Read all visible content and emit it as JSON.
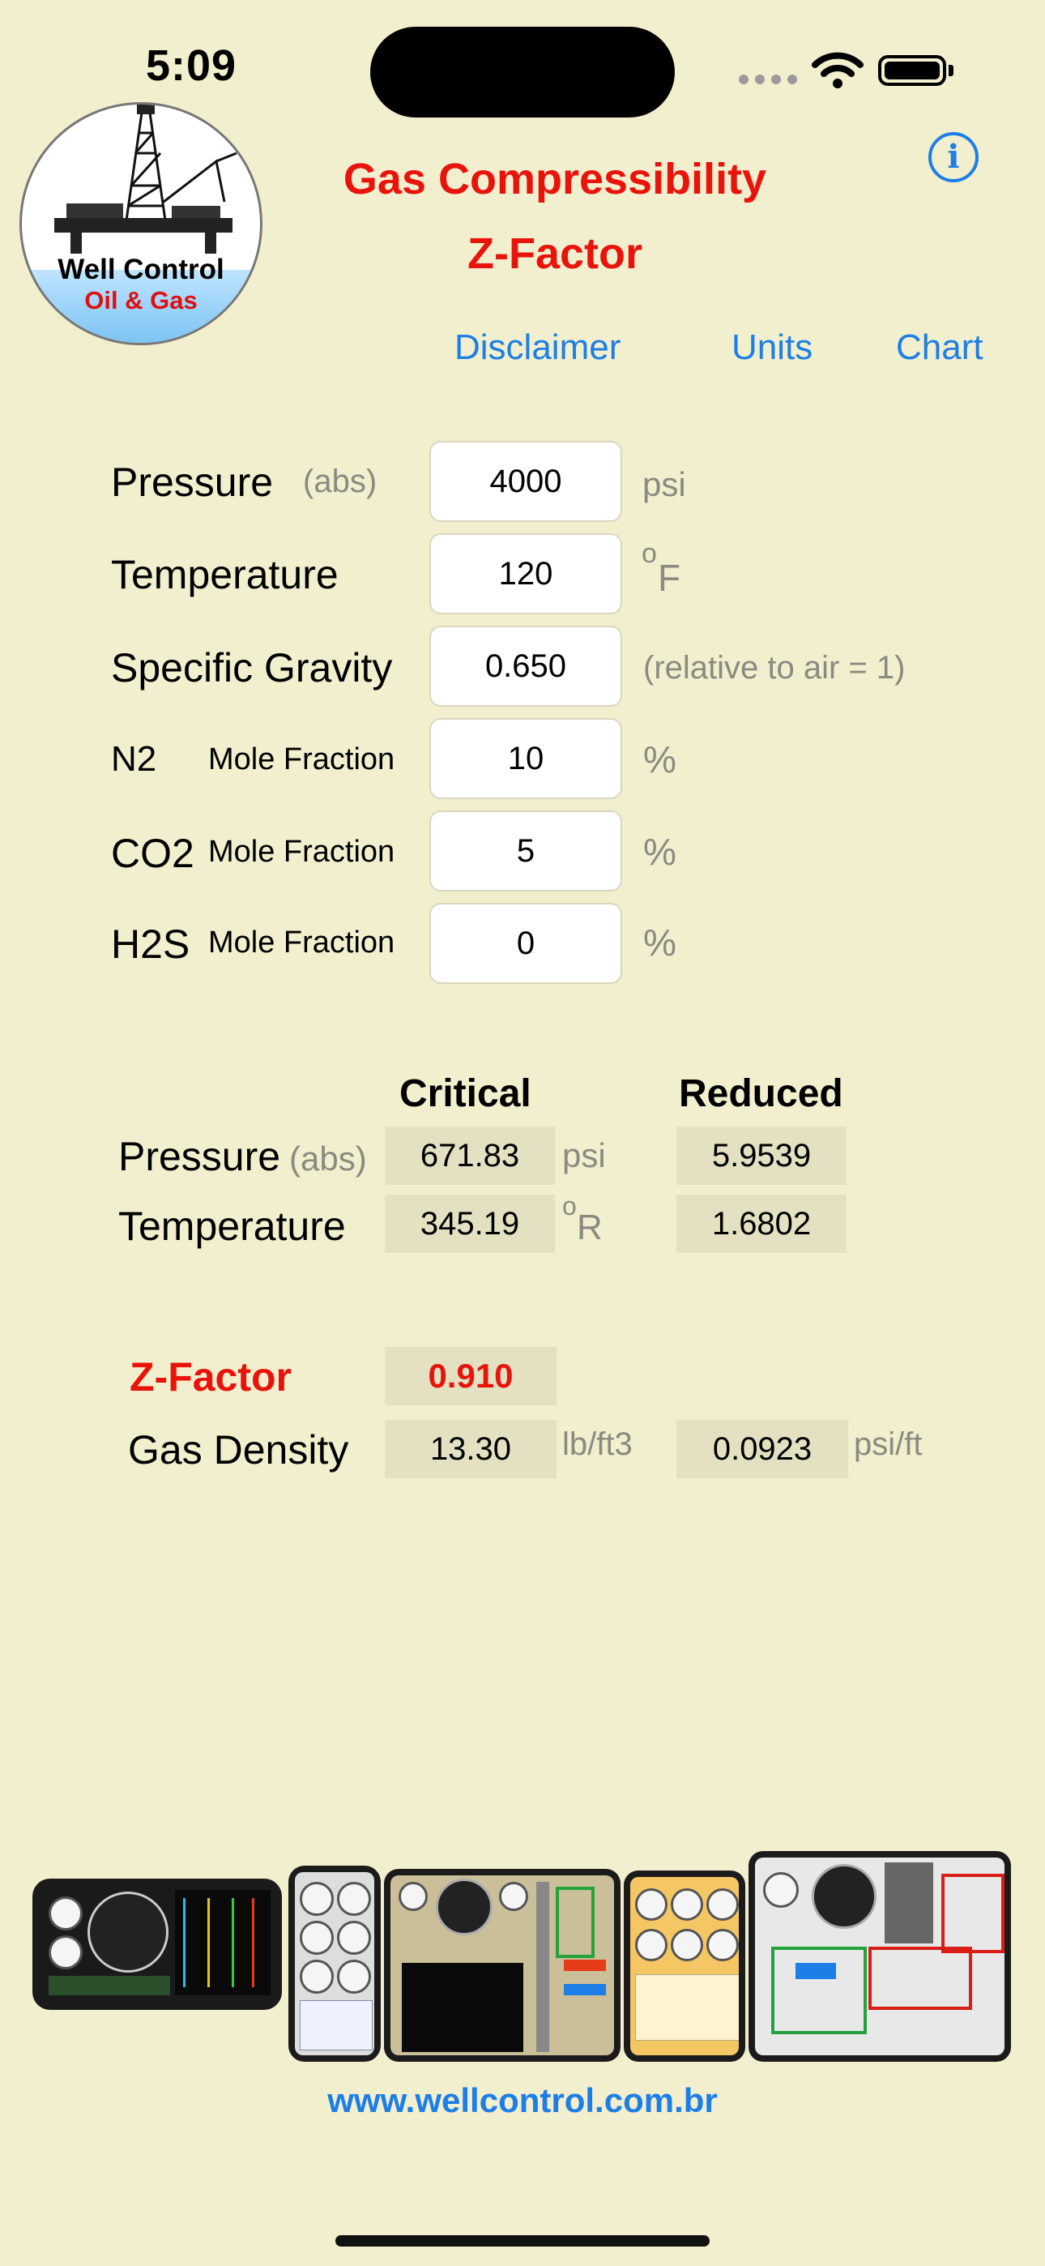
{
  "status_bar": {
    "time": "5:09"
  },
  "logo": {
    "title": "Well Control",
    "subtitle": "Oil & Gas"
  },
  "header": {
    "title_line1": "Gas Compressibility",
    "title_line2": "Z-Factor",
    "info_icon": "info-icon"
  },
  "nav": {
    "disclaimer": "Disclaimer",
    "units": "Units",
    "chart": "Chart"
  },
  "inputs": {
    "pressure": {
      "label": "Pressure",
      "qualifier": "(abs)",
      "value": "4000",
      "unit": "psi"
    },
    "temperature": {
      "label": "Temperature",
      "value": "120",
      "unit_sup": "o",
      "unit": "F"
    },
    "specific_gravity": {
      "label": "Specific Gravity",
      "value": "0.650",
      "note": "(relative to air = 1)"
    },
    "n2": {
      "label": "N2",
      "sub": "Mole Fraction",
      "value": "10",
      "unit": "%"
    },
    "co2": {
      "label": "CO2",
      "sub": "Mole Fraction",
      "value": "5",
      "unit": "%"
    },
    "h2s": {
      "label": "H2S",
      "sub": "Mole Fraction",
      "value": "0",
      "unit": "%"
    }
  },
  "results": {
    "critical_header": "Critical",
    "reduced_header": "Reduced",
    "pressure": {
      "label": "Pressure",
      "qualifier": "(abs)",
      "critical": "671.83",
      "unit": "psi",
      "reduced": "5.9539"
    },
    "temperature": {
      "label": "Temperature",
      "critical": "345.19",
      "unit_sup": "o",
      "unit": "R",
      "reduced": "1.6802"
    },
    "z_factor": {
      "label": "Z-Factor",
      "value": "0.910"
    },
    "gas_density": {
      "label": "Gas Density",
      "value": "13.30",
      "unit": "lb/ft3",
      "gradient": "0.0923",
      "gradient_unit": "psi/ft"
    }
  },
  "footer": {
    "website": "www.wellcontrol.com.br"
  }
}
